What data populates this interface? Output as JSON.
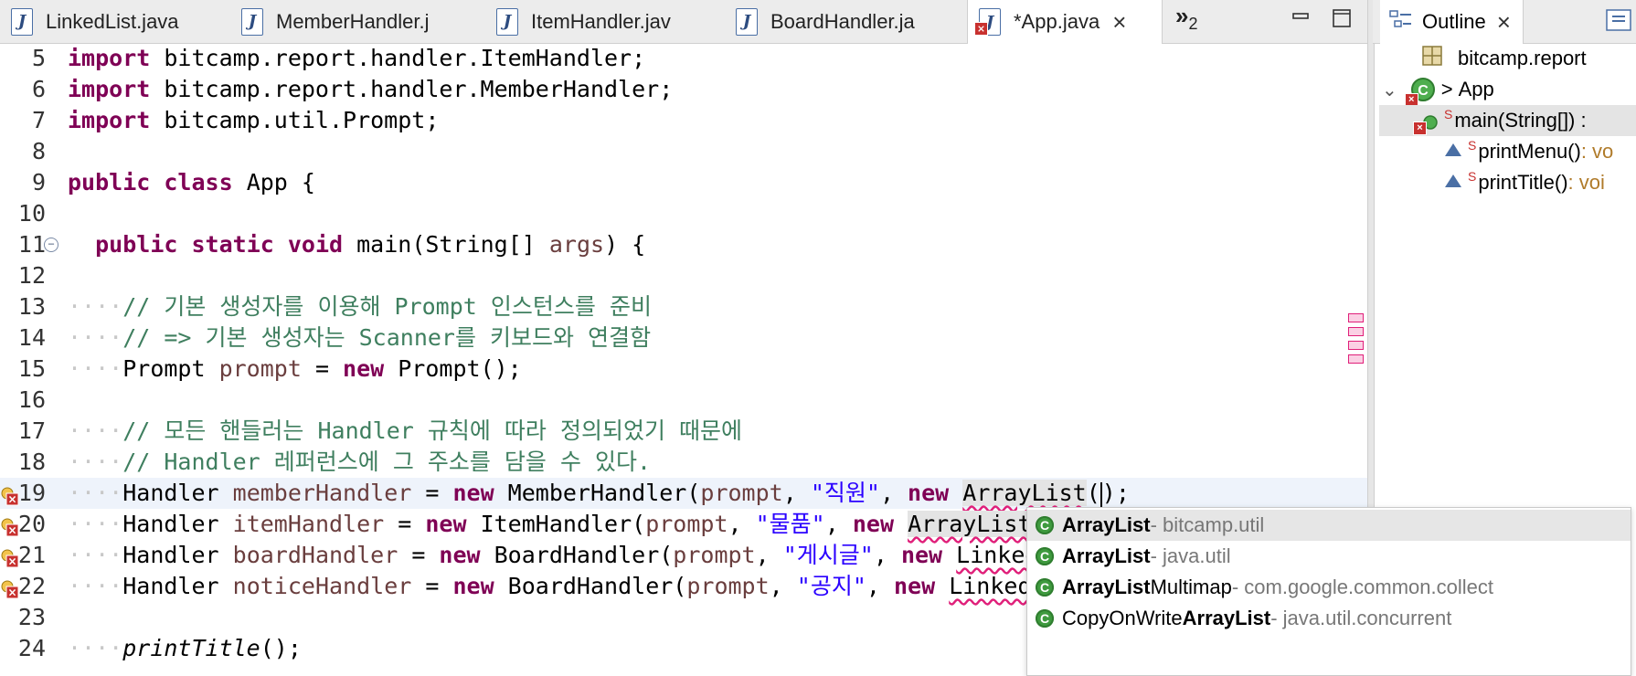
{
  "editor": {
    "tabs": [
      {
        "label": "LinkedList.java",
        "active": false
      },
      {
        "label": "MemberHandler.j",
        "active": false
      },
      {
        "label": "ItemHandler.jav",
        "active": false
      },
      {
        "label": "BoardHandler.ja",
        "active": false
      },
      {
        "label": "*App.java",
        "active": true
      }
    ],
    "overflow_label": "»",
    "overflow_count": "2",
    "lines": [
      {
        "n": "5",
        "code": [
          [
            "kw",
            "import"
          ],
          [
            "t",
            " bitcamp.report.handler.ItemHandler;"
          ]
        ]
      },
      {
        "n": "6",
        "code": [
          [
            "kw",
            "import"
          ],
          [
            "t",
            " bitcamp.report.handler.MemberHandler;"
          ]
        ]
      },
      {
        "n": "7",
        "code": [
          [
            "kw",
            "import"
          ],
          [
            "t",
            " bitcamp.util.Prompt;"
          ]
        ]
      },
      {
        "n": "8",
        "code": []
      },
      {
        "n": "9",
        "code": [
          [
            "kw",
            "public"
          ],
          [
            "t",
            " "
          ],
          [
            "kw",
            "class"
          ],
          [
            "t",
            " App {"
          ]
        ]
      },
      {
        "n": "10",
        "code": []
      },
      {
        "n": "11",
        "code": [
          [
            "t",
            "  "
          ],
          [
            "kw",
            "public"
          ],
          [
            "t",
            " "
          ],
          [
            "kw",
            "static"
          ],
          [
            "t",
            " "
          ],
          [
            "kw",
            "void"
          ],
          [
            "t",
            " main(String[] "
          ],
          [
            "var",
            "args"
          ],
          [
            "t",
            ") {"
          ]
        ]
      },
      {
        "n": "12",
        "code": []
      },
      {
        "n": "13",
        "code": [
          [
            "dot",
            "····"
          ],
          [
            "cm",
            "// 기본 생성자를 이용해 Prompt 인스턴스를 준비"
          ]
        ]
      },
      {
        "n": "14",
        "code": [
          [
            "dot",
            "····"
          ],
          [
            "cm",
            "// => 기본 생성자는 Scanner를 키보드와 연결함"
          ]
        ]
      },
      {
        "n": "15",
        "code": [
          [
            "dot",
            "····"
          ],
          [
            "t",
            "Prompt "
          ],
          [
            "var",
            "prompt"
          ],
          [
            "t",
            " = "
          ],
          [
            "kw",
            "new"
          ],
          [
            "t",
            " Prompt();"
          ]
        ]
      },
      {
        "n": "16",
        "code": []
      },
      {
        "n": "17",
        "code": [
          [
            "dot",
            "····"
          ],
          [
            "cm",
            "// 모든 핸들러는 Handler 규칙에 따라 정의되었기 때문에"
          ]
        ]
      },
      {
        "n": "18",
        "code": [
          [
            "dot",
            "····"
          ],
          [
            "cm",
            "// Handler 레퍼런스에 그 주소를 담을 수 있다."
          ]
        ]
      },
      {
        "n": "19",
        "code": [
          [
            "dot",
            "····"
          ],
          [
            "t",
            "Handler "
          ],
          [
            "var",
            "memberHandler"
          ],
          [
            "t",
            " = "
          ],
          [
            "kw",
            "new"
          ],
          [
            "t",
            " MemberHandler("
          ],
          [
            "var",
            "prompt"
          ],
          [
            "t",
            ", "
          ],
          [
            "str",
            "\"직원\""
          ],
          [
            "t",
            ", "
          ],
          [
            "kw",
            "new"
          ],
          [
            "t",
            " "
          ],
          [
            "sqb",
            "ArrayList"
          ],
          [
            "t",
            "("
          ],
          [
            "caret",
            ""
          ],
          [
            "t",
            ");"
          ]
        ]
      },
      {
        "n": "20",
        "code": [
          [
            "dot",
            "····"
          ],
          [
            "t",
            "Handler "
          ],
          [
            "var",
            "itemHandler"
          ],
          [
            "t",
            " = "
          ],
          [
            "kw",
            "new"
          ],
          [
            "t",
            " ItemHandler("
          ],
          [
            "var",
            "prompt"
          ],
          [
            "t",
            ", "
          ],
          [
            "str",
            "\"물품\""
          ],
          [
            "t",
            ", "
          ],
          [
            "kw",
            "new"
          ],
          [
            "t",
            " "
          ],
          [
            "sqb",
            "ArrayList"
          ],
          [
            "t",
            "());"
          ]
        ]
      },
      {
        "n": "21",
        "code": [
          [
            "dot",
            "····"
          ],
          [
            "t",
            "Handler "
          ],
          [
            "var",
            "boardHandler"
          ],
          [
            "t",
            " = "
          ],
          [
            "kw",
            "new"
          ],
          [
            "t",
            " BoardHandler("
          ],
          [
            "var",
            "prompt"
          ],
          [
            "t",
            ", "
          ],
          [
            "str",
            "\"게시글\""
          ],
          [
            "t",
            ", "
          ],
          [
            "kw",
            "new"
          ],
          [
            "t",
            " "
          ],
          [
            "sq",
            "LinkedLis"
          ]
        ]
      },
      {
        "n": "22",
        "code": [
          [
            "dot",
            "····"
          ],
          [
            "t",
            "Handler "
          ],
          [
            "var",
            "noticeHandler"
          ],
          [
            "t",
            " = "
          ],
          [
            "kw",
            "new"
          ],
          [
            "t",
            " BoardHandler("
          ],
          [
            "var",
            "prompt"
          ],
          [
            "t",
            ", "
          ],
          [
            "str",
            "\"공지\""
          ],
          [
            "t",
            ", "
          ],
          [
            "kw",
            "new"
          ],
          [
            "t",
            " "
          ],
          [
            "sq",
            "LinkedList"
          ]
        ]
      },
      {
        "n": "23",
        "code": []
      },
      {
        "n": "24",
        "code": [
          [
            "dot",
            "····"
          ],
          [
            "it",
            "printTitle"
          ],
          [
            "t",
            "();"
          ]
        ]
      }
    ]
  },
  "autocomplete": {
    "items": [
      {
        "pre": "",
        "bold": "ArrayList",
        "post": "",
        "qualifier": " - bitcamp.util",
        "selected": true
      },
      {
        "pre": "",
        "bold": "ArrayList",
        "post": "",
        "qualifier": " - java.util",
        "selected": false
      },
      {
        "pre": "",
        "bold": "ArrayList",
        "post": "Multimap",
        "qualifier": " - com.google.common.collect",
        "selected": false
      },
      {
        "pre": "CopyOnWrite",
        "bold": "ArrayList",
        "post": "",
        "qualifier": " - java.util.concurrent",
        "selected": false
      }
    ]
  },
  "outline": {
    "tab_label": "Outline",
    "package": "bitcamp.report",
    "class_prefix": ">",
    "class_name": "App",
    "members": [
      {
        "name": "main(String[]) :",
        "type": "",
        "selected": true,
        "static_mark": "S"
      },
      {
        "name": "printMenu()",
        "type": " : vo",
        "selected": false,
        "static_mark": "S"
      },
      {
        "name": "printTitle()",
        "type": " : voi",
        "selected": false,
        "static_mark": "S"
      }
    ]
  },
  "colors": {
    "keyword": "#7f0055",
    "comment": "#3f7f5f",
    "string": "#2a00ff",
    "error": "#c8312f"
  }
}
